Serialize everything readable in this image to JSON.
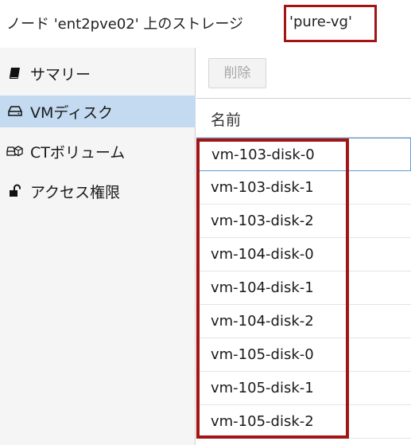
{
  "header": {
    "prefix": "ノード 'ent2pve02' 上のストレージ",
    "storage_name": "'pure-vg'"
  },
  "sidebar": {
    "items": [
      {
        "label": "サマリー",
        "icon": "book-icon",
        "selected": false
      },
      {
        "label": "VMディスク",
        "icon": "hdd-icon",
        "selected": true
      },
      {
        "label": "CTボリューム",
        "icon": "ct-volume-icon",
        "selected": false
      },
      {
        "label": "アクセス権限",
        "icon": "unlock-icon",
        "selected": false
      }
    ]
  },
  "toolbar": {
    "delete_label": "削除"
  },
  "table": {
    "column_name": "名前",
    "rows": [
      "vm-103-disk-0",
      "vm-103-disk-1",
      "vm-103-disk-2",
      "vm-104-disk-0",
      "vm-104-disk-1",
      "vm-104-disk-2",
      "vm-105-disk-0",
      "vm-105-disk-1",
      "vm-105-disk-2"
    ]
  },
  "colors": {
    "highlight": "#a31515",
    "selected_bg": "#c3daf0",
    "sidebar_bg": "#f5f5f5"
  }
}
